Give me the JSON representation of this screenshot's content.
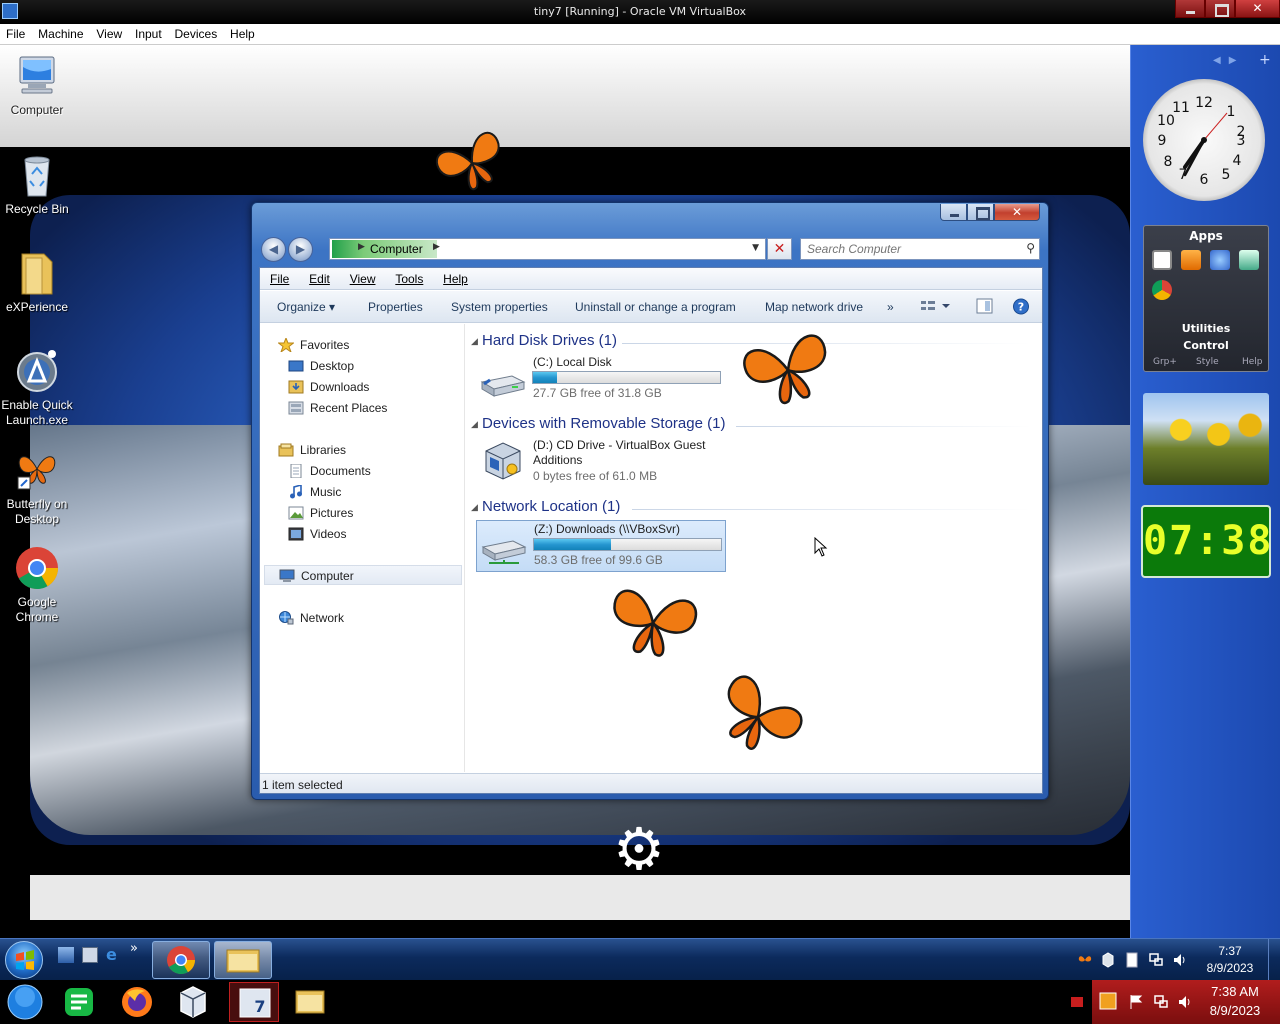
{
  "host": {
    "window_title": "tiny7 [Running] - Oracle VM VirtualBox",
    "menu": [
      "File",
      "Machine",
      "View",
      "Input",
      "Devices",
      "Help"
    ],
    "close_glyph": "✕"
  },
  "desktop": {
    "icons": [
      {
        "label": "Computer",
        "icon": "computer-icon"
      },
      {
        "label": "Recycle Bin",
        "icon": "recycle-bin-icon"
      },
      {
        "label": "eXPerience",
        "icon": "folder-icon"
      },
      {
        "label": "Enable Quick Launch.exe",
        "icon": "app-icon"
      },
      {
        "label": "Butterfly on Desktop",
        "icon": "butterfly-icon"
      },
      {
        "label": "Google Chrome",
        "icon": "chrome-icon"
      }
    ]
  },
  "sidebar": {
    "apps_gadget": {
      "title": "Apps",
      "utilities": "Utilities",
      "control": "Control",
      "links": [
        "Grp+",
        "Style",
        "Help"
      ]
    },
    "digital_clock": "07:38",
    "analog_clock_time": "7:38"
  },
  "explorer": {
    "close_glyph": "✕",
    "address_crumb": "Computer",
    "search_placeholder": "Search Computer",
    "menu": [
      "File",
      "Edit",
      "View",
      "Tools",
      "Help"
    ],
    "commands": [
      "Organize",
      "Properties",
      "System properties",
      "Uninstall or change a program",
      "Map network drive"
    ],
    "overflow_glyph": "»",
    "nav": {
      "favorites": "Favorites",
      "favorites_items": [
        "Desktop",
        "Downloads",
        "Recent Places"
      ],
      "libraries": "Libraries",
      "libraries_items": [
        "Documents",
        "Music",
        "Pictures",
        "Videos"
      ],
      "computer": "Computer",
      "network": "Network"
    },
    "groups": [
      {
        "title": "Hard Disk Drives (1)",
        "items": [
          {
            "name": "(C:) Local Disk",
            "free": "27.7 GB free of 31.8 GB",
            "used_fraction": 0.13
          }
        ]
      },
      {
        "title": "Devices with Removable Storage (1)",
        "items": [
          {
            "name": "(D:) CD Drive - VirtualBox Guest Additions",
            "free": "0 bytes free of 61.0 MB"
          }
        ]
      },
      {
        "title": "Network Location (1)",
        "items": [
          {
            "name": "(Z:) Downloads (\\\\VBoxSvr)",
            "free": "58.3 GB free of 99.6 GB",
            "used_fraction": 0.41,
            "selected": true
          }
        ]
      }
    ],
    "status": "1 item selected"
  },
  "guest_taskbar": {
    "quick_launch_overflow": "»",
    "time": "7:37",
    "date": "8/9/2023"
  },
  "host_taskbar": {
    "time": "7:38 AM",
    "date": "8/9/2023"
  },
  "colors": {
    "guest_taskbar": "#0c2a5c",
    "host_tray": "#9b1414",
    "sidebar": "#2a5fd0",
    "digital_clock_bg": "#0b7a0a",
    "digital_clock_fg": "#e8ff2a",
    "drive_bar_fill": "#2696d0"
  }
}
